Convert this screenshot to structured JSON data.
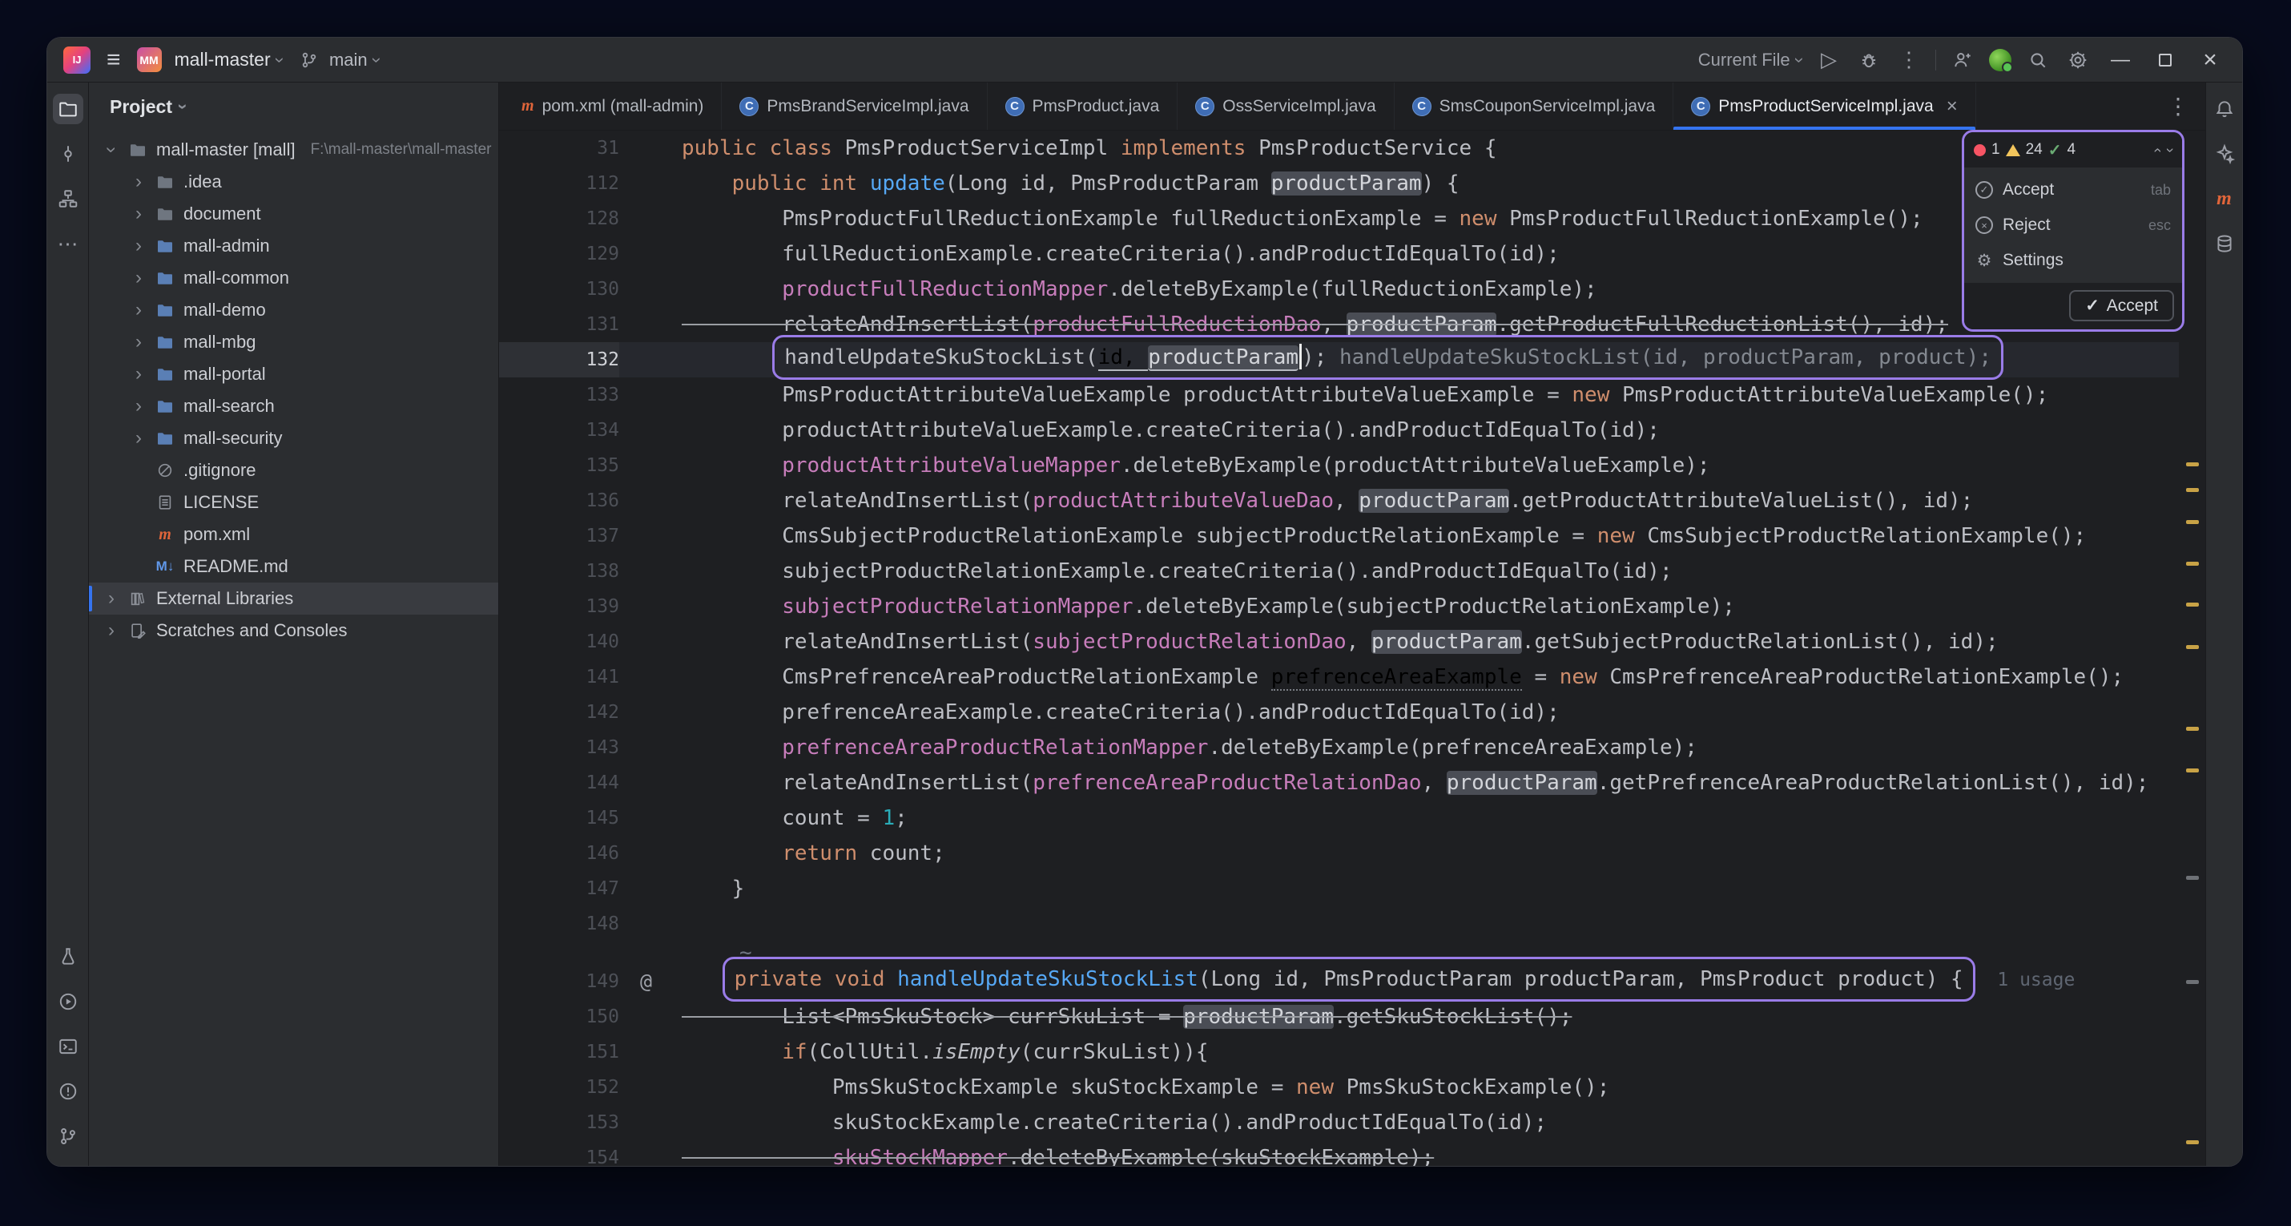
{
  "titlebar": {
    "project_badge": "MM",
    "project_name": "mall-master",
    "vcs_branch": "main",
    "run_config": "Current File"
  },
  "left_stripe": {
    "top": [
      "project-folder",
      "commit",
      "structure",
      "more"
    ],
    "bottom": [
      "build",
      "services",
      "terminal",
      "problems",
      "version-control"
    ]
  },
  "right_stripe": [
    "notifications",
    "ai-assistant",
    "maven",
    "database"
  ],
  "project_panel": {
    "header": "Project",
    "items": [
      {
        "label": "mall-master [mall]",
        "path": "F:\\mall-master\\mall-master",
        "type": "folder",
        "level": 0,
        "chevron": "open"
      },
      {
        "label": ".idea",
        "type": "folder",
        "level": 1,
        "chevron": "closed"
      },
      {
        "label": "document",
        "type": "folder",
        "level": 1,
        "chevron": "closed"
      },
      {
        "label": "mall-admin",
        "type": "module",
        "level": 1,
        "chevron": "closed"
      },
      {
        "label": "mall-common",
        "type": "module",
        "level": 1,
        "chevron": "closed"
      },
      {
        "label": "mall-demo",
        "type": "module",
        "level": 1,
        "chevron": "closed"
      },
      {
        "label": "mall-mbg",
        "type": "module",
        "level": 1,
        "chevron": "closed"
      },
      {
        "label": "mall-portal",
        "type": "module",
        "level": 1,
        "chevron": "closed"
      },
      {
        "label": "mall-search",
        "type": "module",
        "level": 1,
        "chevron": "closed"
      },
      {
        "label": "mall-security",
        "type": "module",
        "level": 1,
        "chevron": "closed"
      },
      {
        "label": ".gitignore",
        "type": "ignored",
        "level": 1
      },
      {
        "label": "LICENSE",
        "type": "text",
        "level": 1
      },
      {
        "label": "pom.xml",
        "type": "maven",
        "level": 1
      },
      {
        "label": "README.md",
        "type": "markdown",
        "level": 1
      },
      {
        "label": "External Libraries",
        "type": "libraries",
        "level": 0,
        "chevron": "closed",
        "selected": true
      },
      {
        "label": "Scratches and Consoles",
        "type": "scratches",
        "level": 0,
        "chevron": "closed"
      }
    ]
  },
  "tabs": [
    {
      "label": "pom.xml (mall-admin)",
      "icon": "maven"
    },
    {
      "label": "PmsBrandServiceImpl.java",
      "icon": "class"
    },
    {
      "label": "PmsProduct.java",
      "icon": "class"
    },
    {
      "label": "OssServiceImpl.java",
      "icon": "class"
    },
    {
      "label": "SmsCouponServiceImpl.java",
      "icon": "class"
    },
    {
      "label": "PmsProductServiceImpl.java",
      "icon": "class",
      "active": true
    }
  ],
  "editor": {
    "lines": [
      {
        "n": "31",
        "t": [
          [
            "k",
            "public"
          ],
          [
            "d",
            " "
          ],
          [
            "k",
            "class"
          ],
          [
            "d",
            " PmsProductServiceImpl "
          ],
          [
            "k",
            "implements"
          ],
          [
            "d",
            " PmsProductService {"
          ]
        ]
      },
      {
        "n": "112",
        "t": [
          [
            "d",
            "    "
          ],
          [
            "k",
            "public"
          ],
          [
            "d",
            " "
          ],
          [
            "k",
            "int"
          ],
          [
            "d",
            " "
          ],
          [
            "m",
            "update"
          ],
          [
            "d",
            "(Long id, PmsProductParam "
          ],
          [
            "box",
            "productParam"
          ],
          [
            "d",
            ") {"
          ]
        ]
      },
      {
        "n": "128",
        "t": [
          [
            "d",
            "        PmsProductFullReductionExample fullReductionExample = "
          ],
          [
            "k",
            "new"
          ],
          [
            "d",
            " PmsProductFullReductionExample();"
          ]
        ]
      },
      {
        "n": "129",
        "t": [
          [
            "d",
            "        fullReductionExample.createCriteria().andProductIdEqualTo(id);"
          ]
        ]
      },
      {
        "n": "130",
        "t": [
          [
            "d",
            "        "
          ],
          [
            "f",
            "productFullReductionMapper"
          ],
          [
            "d",
            ".deleteByExample(fullReductionExample);"
          ]
        ]
      },
      {
        "n": "131",
        "strike": true,
        "t": [
          [
            "d",
            "        relateAndInsertList("
          ],
          [
            "f",
            "productFullReductionDao"
          ],
          [
            "d",
            ", "
          ],
          [
            "box",
            "productParam"
          ],
          [
            "d",
            ".getProductFullReductionList(), id);"
          ]
        ]
      },
      {
        "n": "132",
        "current": true,
        "pre": [
          [
            "d",
            "        "
          ]
        ],
        "boxed": [
          [
            "d",
            "handleUpdateSkuStockList("
          ],
          [
            "u",
            "id, "
          ],
          [
            "boxu",
            "productParam"
          ],
          [
            "caret",
            ""
          ],
          [
            "d",
            ");"
          ],
          [
            "d",
            " "
          ],
          [
            "g",
            "handleUpdateSkuStockList(id, productParam, product);"
          ]
        ],
        "t": []
      },
      {
        "n": "133",
        "t": [
          [
            "d",
            "        PmsProductAttributeValueExample productAttributeValueExample = "
          ],
          [
            "k",
            "new"
          ],
          [
            "d",
            " PmsProductAttributeValueExample();"
          ]
        ]
      },
      {
        "n": "134",
        "t": [
          [
            "d",
            "        productAttributeValueExample.createCriteria().andProductIdEqualTo(id);"
          ]
        ]
      },
      {
        "n": "135",
        "t": [
          [
            "d",
            "        "
          ],
          [
            "f",
            "productAttributeValueMapper"
          ],
          [
            "d",
            ".deleteByExample(productAttributeValueExample);"
          ]
        ]
      },
      {
        "n": "136",
        "t": [
          [
            "d",
            "        relateAndInsertList("
          ],
          [
            "f",
            "productAttributeValueDao"
          ],
          [
            "d",
            ", "
          ],
          [
            "box",
            "productParam"
          ],
          [
            "d",
            ".getProductAttributeValueList(), id);"
          ]
        ]
      },
      {
        "n": "137",
        "t": [
          [
            "d",
            "        CmsSubjectProductRelationExample subjectProductRelationExample = "
          ],
          [
            "k",
            "new"
          ],
          [
            "d",
            " CmsSubjectProductRelationExample();"
          ]
        ]
      },
      {
        "n": "138",
        "t": [
          [
            "d",
            "        subjectProductRelationExample.createCriteria().andProductIdEqualTo(id);"
          ]
        ]
      },
      {
        "n": "139",
        "t": [
          [
            "d",
            "        "
          ],
          [
            "f",
            "subjectProductRelationMapper"
          ],
          [
            "d",
            ".deleteByExample(subjectProductRelationExample);"
          ]
        ]
      },
      {
        "n": "140",
        "t": [
          [
            "d",
            "        relateAndInsertList("
          ],
          [
            "f",
            "subjectProductRelationDao"
          ],
          [
            "d",
            ", "
          ],
          [
            "box",
            "productParam"
          ],
          [
            "d",
            ".getSubjectProductRelationList(), id);"
          ]
        ]
      },
      {
        "n": "141",
        "t": [
          [
            "d",
            "        CmsPrefrenceAreaProductRelationExample "
          ],
          [
            "typo",
            "prefrenceAreaExample"
          ],
          [
            "d",
            " = "
          ],
          [
            "k",
            "new"
          ],
          [
            "d",
            " CmsPrefrenceAreaProductRelationExample();"
          ]
        ]
      },
      {
        "n": "142",
        "t": [
          [
            "d",
            "        prefrenceAreaExample.createCriteria().andProductIdEqualTo(id);"
          ]
        ]
      },
      {
        "n": "143",
        "t": [
          [
            "d",
            "        "
          ],
          [
            "f",
            "prefrenceAreaProductRelationMapper"
          ],
          [
            "d",
            ".deleteByExample(prefrenceAreaExample);"
          ]
        ]
      },
      {
        "n": "144",
        "t": [
          [
            "d",
            "        relateAndInsertList("
          ],
          [
            "f",
            "prefrenceAreaProductRelationDao"
          ],
          [
            "d",
            ", "
          ],
          [
            "box",
            "productParam"
          ],
          [
            "d",
            ".getPrefrenceAreaProductRelationList(), id);"
          ]
        ]
      },
      {
        "n": "145",
        "t": [
          [
            "d",
            "        count = "
          ],
          [
            "num",
            "1"
          ],
          [
            "d",
            ";"
          ]
        ]
      },
      {
        "n": "146",
        "t": [
          [
            "d",
            "        "
          ],
          [
            "k",
            "return"
          ],
          [
            "d",
            " count;"
          ]
        ]
      },
      {
        "n": "147",
        "t": [
          [
            "d",
            "    }"
          ]
        ]
      },
      {
        "n": "148",
        "t": []
      },
      {
        "spacer": true,
        "marker": "~"
      },
      {
        "n": "149",
        "gutter": "@",
        "pre": [
          [
            "d",
            "    "
          ]
        ],
        "boxed": [
          [
            "k",
            "private"
          ],
          [
            "d",
            " "
          ],
          [
            "k",
            "void"
          ],
          [
            "d",
            " "
          ],
          [
            "m",
            "handleUpdateSkuStockList"
          ],
          [
            "d",
            "(Long id, PmsProductParam productParam, PmsProduct product) {"
          ]
        ],
        "t": [
          [
            "hint",
            "  1 usage"
          ]
        ]
      },
      {
        "n": "150",
        "strike": true,
        "t": [
          [
            "d",
            "        List<PmsSkuStock> currSkuList = "
          ],
          [
            "box",
            "productParam"
          ],
          [
            "d",
            ".getSkuStockList();"
          ]
        ]
      },
      {
        "n": "151",
        "t": [
          [
            "d",
            "        "
          ],
          [
            "k",
            "if"
          ],
          [
            "d",
            "(CollUtil."
          ],
          [
            "i",
            "isEmpty"
          ],
          [
            "d",
            "(currSkuList)){"
          ]
        ]
      },
      {
        "n": "152",
        "t": [
          [
            "d",
            "            PmsSkuStockExample skuStockExample = "
          ],
          [
            "k",
            "new"
          ],
          [
            "d",
            " PmsSkuStockExample();"
          ]
        ]
      },
      {
        "n": "153",
        "t": [
          [
            "d",
            "            skuStockExample.createCriteria().andProductIdEqualTo(id);"
          ]
        ]
      },
      {
        "n": "154",
        "strike": true,
        "t": [
          [
            "d",
            "            "
          ],
          [
            "f",
            "skuStockMapper"
          ],
          [
            "d",
            ".deleteByExample(skuStockExample);"
          ]
        ]
      }
    ]
  },
  "popup": {
    "error_count": "1",
    "warning_count": "24",
    "ok_count": "4",
    "items": [
      {
        "label": "Accept",
        "kbd": "tab"
      },
      {
        "label": "Reject",
        "kbd": "esc"
      },
      {
        "label": "Settings",
        "kbd": ""
      }
    ],
    "accept_button": "Accept"
  },
  "error_stripe": {
    "yellow": [
      414,
      446,
      486,
      538,
      589,
      642,
      744,
      796,
      1260
    ],
    "gray": [
      930,
      1060
    ]
  }
}
